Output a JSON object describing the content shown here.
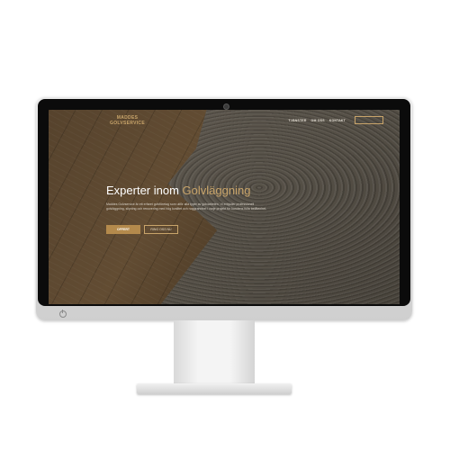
{
  "site": {
    "logo_line1": "MADDES",
    "logo_line2": "GOLVSERVICE"
  },
  "nav": {
    "items": [
      "TJÄNSTER",
      "OM OSS",
      "KONTAKT"
    ],
    "cta_label": ""
  },
  "hero": {
    "title_plain": "Experter inom ",
    "title_accent": "Golvläggning",
    "body_text": "Maddes Golvservice är ett erfaret golvföretag som utför alla typer av golvarbeten. Vi erbjuder professionell golvläggning, slipning och renovering med hög kvalitet och noggrannhet i varje projekt för kundens fulla belåtenhet.",
    "primary_button": "OFFERT",
    "secondary_button": "RING OSS NU"
  },
  "colors": {
    "accent": "#c8a46a",
    "accent_button": "#b48a4c"
  },
  "icons": {
    "power": "power-icon",
    "camera": "camera-icon"
  }
}
